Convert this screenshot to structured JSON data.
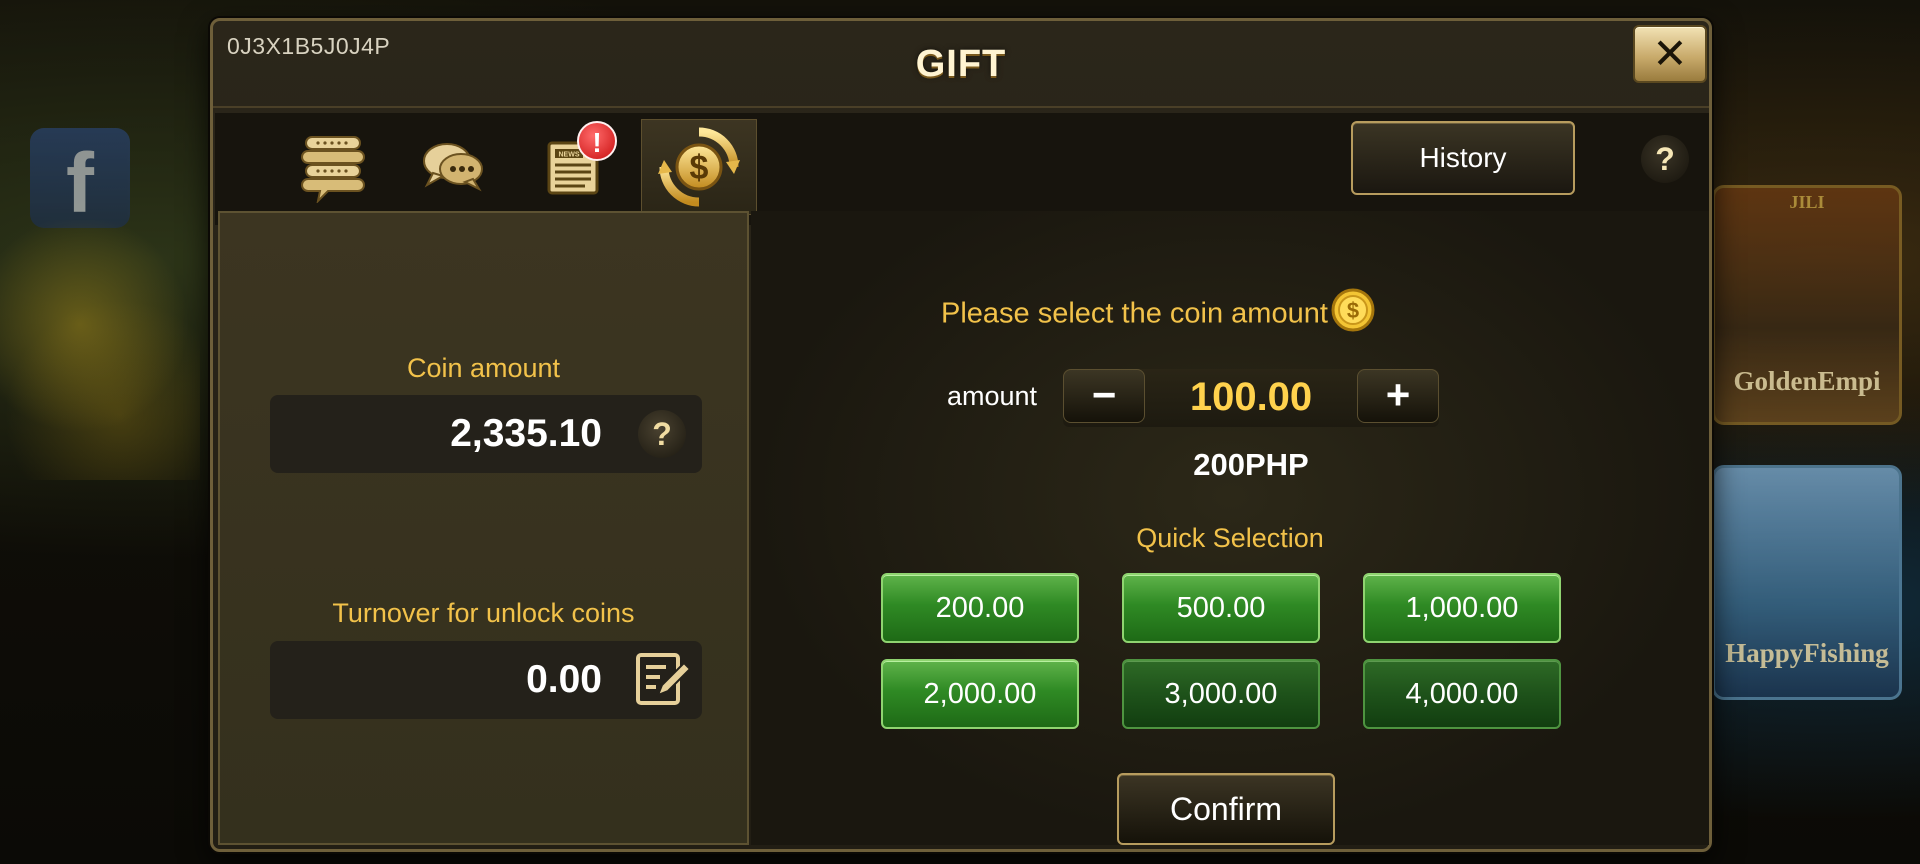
{
  "modal": {
    "user_id": "0J3X1B5J0J4P",
    "title": "GIFT",
    "close_label": "✕"
  },
  "tabs": [
    {
      "icon": "scroll-icon"
    },
    {
      "icon": "chat-bubbles-icon"
    },
    {
      "icon": "news-icon",
      "badge": "!"
    },
    {
      "icon": "dollar-exchange-icon",
      "active": true
    }
  ],
  "header": {
    "history_label": "History",
    "help_label": "?"
  },
  "left_panel": {
    "coin_amount_label": "Coin amount",
    "coin_amount_value": "2,335.10",
    "coin_help": "?",
    "turnover_label": "Turnover for unlock coins",
    "turnover_value": "0.00"
  },
  "right_panel": {
    "prompt": "Please select the coin amount",
    "amount_label": "amount",
    "minus_label": "−",
    "plus_label": "+",
    "amount_value": "100.00",
    "php_value": "200PHP",
    "quick_selection_label": "Quick Selection",
    "quick_options": [
      "200.00",
      "500.00",
      "1,000.00",
      "2,000.00",
      "3,000.00",
      "4,000.00"
    ],
    "confirm_label": "Confirm"
  },
  "background": {
    "game1_title": "GoldenEmpi",
    "game1_tag": "JILI",
    "game2_title": "HappyFishing",
    "fb_letter": "f"
  },
  "colors": {
    "accent_gold": "#f2c24a",
    "button_green": "#2f8a24",
    "badge_red": "#c80f0f"
  }
}
